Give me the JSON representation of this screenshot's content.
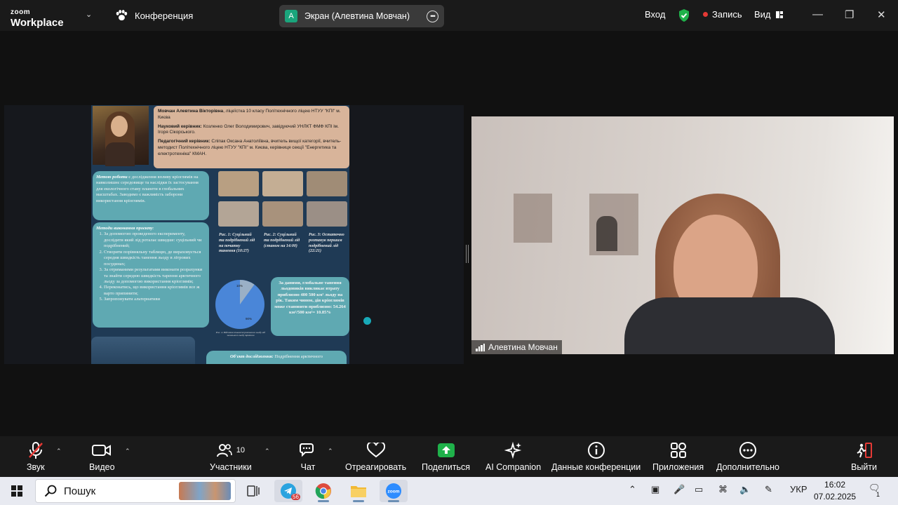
{
  "titlebar": {
    "logo_top": "zoom",
    "logo_bottom": "Workplace",
    "conference_label": "Конференция",
    "share_avatar_letter": "A",
    "share_label": "Экран (Алевтина Мовчан)",
    "signin_label": "Вход",
    "record_label": "Запись",
    "view_label": "Вид",
    "colors": {
      "shield": "#1fb14a",
      "record": "#e53935",
      "avatar": "#1aa57c"
    }
  },
  "poster": {
    "bio_name": "Мовчан Алевтина Вікторівна",
    "bio_line1_rest": ", ліцеїстка 10 класу Політехнічного ліцею НТУУ \"КПІ\" м. Києва",
    "bio_sci_label": "Науковий керівник:",
    "bio_sci_text": " Козленко Олег Володимирович, завідуючий УНЛКТ ФМФ КПІ ім. Ігоря Сікорського.",
    "bio_ped_label": "Педагогічний керівник:",
    "bio_ped_text": " Сліпак Оксана Анатоліївна, вчитель вищої категорії, вчитель-методист Політехнічного ліцею НТУУ \"КПІ\" м. Києва, керівниця секції \"Енергетика та електротехніка\" КМАН.",
    "goal_label": "Метою роботи",
    "goal_text": " є дослідження впливу кріоглямів на навколишнє середовище та наслідки їх застосування для екологічного стану планети в глобальних масштабах. Заводимо є важливість заборони використання кріоглямів.",
    "methods_title": "Методи виконання проєкту",
    "methods": [
      "За допомогою проведеного експерименту, дослідити який лід роталає швидше: суцільний чи подрібнений;",
      "Створити порівняльну таблицю, де вираховується середня швидкість танення льоду в літрових посудинах;",
      "За отриманими результатами виконати розрахунки та знайти середню швидкість тарення арктичного льоду за допомогою використання кріоглямів;",
      "Переконатись, що використання кріоглямів все ж варто припинити;",
      "Запропонувати альтернативи"
    ],
    "captions": [
      "Рис. 1: Суцільний та подрібнений лід на початку танення (10:27)",
      "Рис. 2: Суцільний та подрібнений лід (станом на 14:00)",
      "Рис. 3: Остаточно розтанув першим подрібнений лід (22:21)"
    ],
    "pie_small": "10%",
    "pie_big": "90%",
    "pie_small_value": 10,
    "pie_big_value": 90,
    "pie_caption": "Рис. 4. Відсоток кількості розталого льоду від загального льоду Арктики",
    "result_text": "За даними, глобальне танення льодовиків викликає втрату приблизно 400 500 км² льоду на рік. Таким чином, дія кріоглямів може становити приблизно: 54.264 км²/500 км²= 10.85%",
    "object_label": "Об'єкт дослідження:",
    "object_text": " Подрібнення арктичного",
    "colors": {
      "bg": "#1f3a55",
      "panel": "#5fa9b2",
      "bio": "#d8b49a",
      "pie_big": "#4a86d8",
      "pie_small": "#9ab0c6"
    }
  },
  "video": {
    "participant_name": "Алевтина Мовчан"
  },
  "toolbar": {
    "audio_label": "Звук",
    "video_label": "Видео",
    "participants_label": "Участники",
    "participants_count": "10",
    "chat_label": "Чат",
    "react_label": "Отреагировать",
    "share_label": "Поделиться",
    "ai_label": "AI Companion",
    "info_label": "Данные конференции",
    "apps_label": "Приложения",
    "more_label": "Дополнительно",
    "leave_label": "Выйти",
    "colors": {
      "share": "#1fb14a",
      "leave": "#e53935",
      "mute": "#e53935"
    }
  },
  "taskbar": {
    "search_placeholder": "Пошук",
    "telegram_badge": "56",
    "language": "УКР",
    "time": "16:02",
    "date": "07.02.2025",
    "notif_count": "1"
  }
}
